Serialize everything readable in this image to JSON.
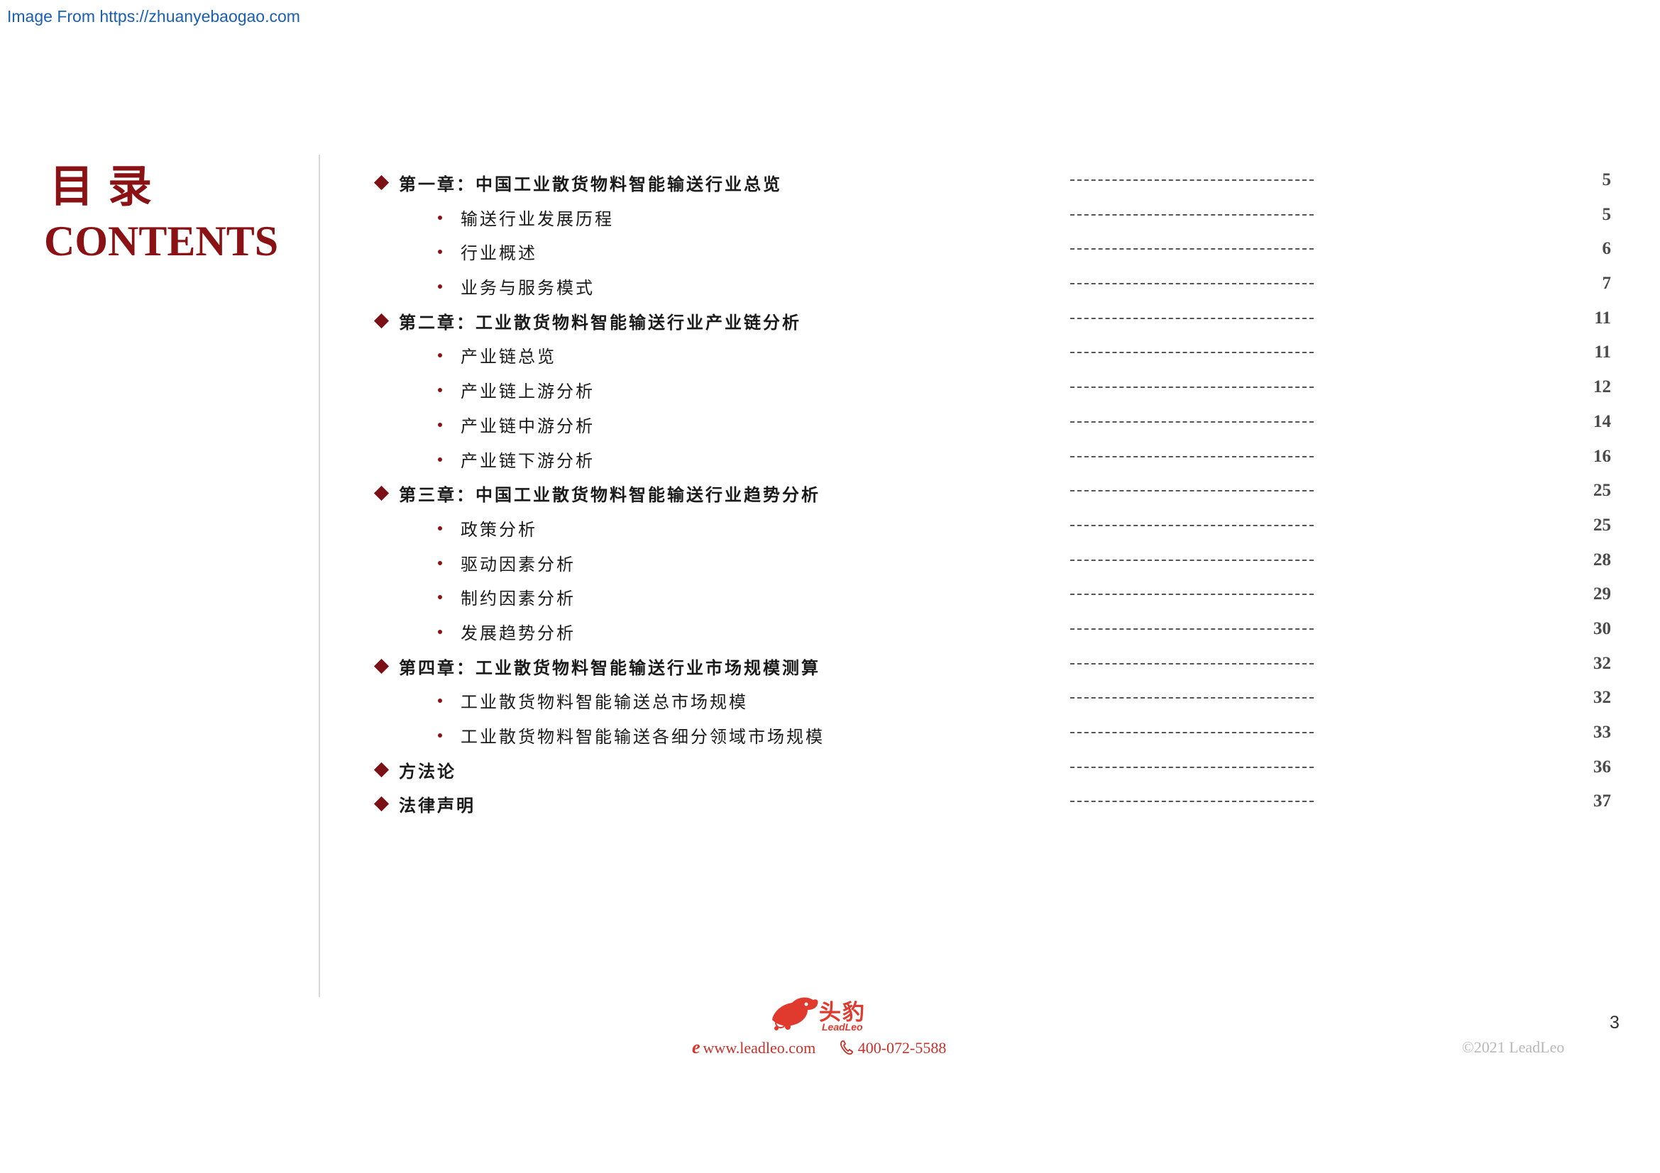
{
  "source": {
    "text": "Image From https://zhuanyebaogao.com"
  },
  "title": {
    "cn": "目录",
    "en": "CONTENTS"
  },
  "toc": [
    {
      "type": "chapter",
      "label": "第一章：中国工业散货物料智能输送行业总览",
      "leader": "----------------------------------------",
      "page": "5"
    },
    {
      "type": "section",
      "label": "输送行业发展历程",
      "leader": "----------------------------------------",
      "page": "5"
    },
    {
      "type": "section",
      "label": "行业概述",
      "leader": "----------------------------------------",
      "page": "6"
    },
    {
      "type": "section",
      "label": "业务与服务模式",
      "leader": "----------------------------------------",
      "page": "7"
    },
    {
      "type": "chapter",
      "label": "第二章：工业散货物料智能输送行业产业链分析",
      "leader": "----------------------------------------",
      "page": "11"
    },
    {
      "type": "section",
      "label": "产业链总览",
      "leader": "----------------------------------------",
      "page": "11"
    },
    {
      "type": "section",
      "label": "产业链上游分析",
      "leader": "----------------------------------------",
      "page": "12"
    },
    {
      "type": "section",
      "label": "产业链中游分析",
      "leader": "----------------------------------------",
      "page": "14"
    },
    {
      "type": "section",
      "label": "产业链下游分析",
      "leader": "----------------------------------------",
      "page": "16"
    },
    {
      "type": "chapter",
      "label": "第三章：中国工业散货物料智能输送行业趋势分析",
      "leader": "----------------------------------------",
      "page": "25"
    },
    {
      "type": "section",
      "label": "政策分析",
      "leader": "----------------------------------------",
      "page": "25"
    },
    {
      "type": "section",
      "label": "驱动因素分析",
      "leader": "----------------------------------------",
      "page": "28"
    },
    {
      "type": "section",
      "label": "制约因素分析",
      "leader": "----------------------------------------",
      "page": "29"
    },
    {
      "type": "section",
      "label": "发展趋势分析",
      "leader": "----------------------------------------",
      "page": "30"
    },
    {
      "type": "chapter",
      "label": "第四章：工业散货物料智能输送行业市场规模测算",
      "leader": "----------------------------------------",
      "page": "32"
    },
    {
      "type": "section",
      "label": "工业散货物料智能输送总市场规模",
      "leader": "----------------------------------------",
      "page": "32"
    },
    {
      "type": "section",
      "label": "工业散货物料智能输送各细分领域市场规模",
      "leader": "----------------------------------------",
      "page": "33"
    },
    {
      "type": "chapter",
      "label": "方法论",
      "leader": "----------------------------------------",
      "page": "36"
    },
    {
      "type": "chapter",
      "label": "法律声明",
      "leader": "----------------------------------------",
      "page": "37"
    }
  ],
  "footer": {
    "logo_cn": "头豹",
    "logo_en": "LeadLeo",
    "website": "www.leadleo.com",
    "phone": "400-072-5588",
    "copyright": "©2021 LeadLeo",
    "page_number": "3"
  },
  "colors": {
    "accent": "#8b1214",
    "brand": "#e03a2f",
    "divider": "#d9d9d9"
  },
  "icons": {
    "chapter_marker": "diamond-icon",
    "section_marker": "bullet-dot-icon",
    "web": "e-icon",
    "phone": "phone-icon",
    "logo": "leopard-logo-icon"
  }
}
